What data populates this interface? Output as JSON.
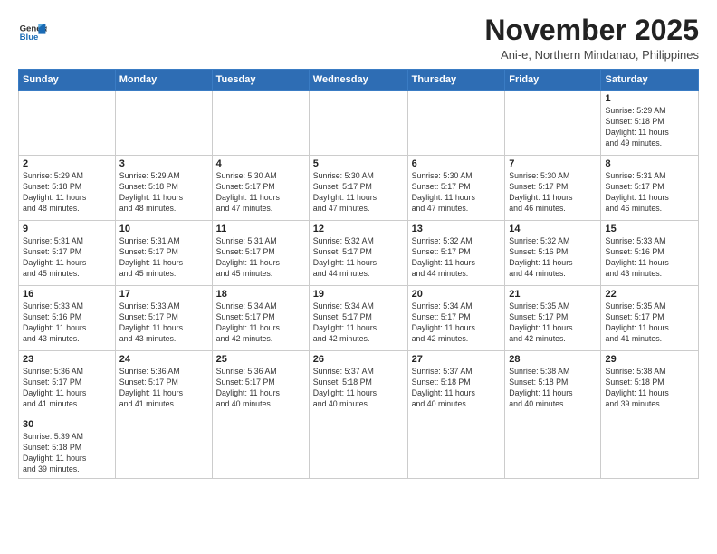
{
  "logo": {
    "line1": "General",
    "line2": "Blue"
  },
  "title": "November 2025",
  "subtitle": "Ani-e, Northern Mindanao, Philippines",
  "weekdays": [
    "Sunday",
    "Monday",
    "Tuesday",
    "Wednesday",
    "Thursday",
    "Friday",
    "Saturday"
  ],
  "weeks": [
    [
      {
        "day": "",
        "info": ""
      },
      {
        "day": "",
        "info": ""
      },
      {
        "day": "",
        "info": ""
      },
      {
        "day": "",
        "info": ""
      },
      {
        "day": "",
        "info": ""
      },
      {
        "day": "",
        "info": ""
      },
      {
        "day": "1",
        "info": "Sunrise: 5:29 AM\nSunset: 5:18 PM\nDaylight: 11 hours\nand 49 minutes."
      }
    ],
    [
      {
        "day": "2",
        "info": "Sunrise: 5:29 AM\nSunset: 5:18 PM\nDaylight: 11 hours\nand 48 minutes."
      },
      {
        "day": "3",
        "info": "Sunrise: 5:29 AM\nSunset: 5:18 PM\nDaylight: 11 hours\nand 48 minutes."
      },
      {
        "day": "4",
        "info": "Sunrise: 5:30 AM\nSunset: 5:17 PM\nDaylight: 11 hours\nand 47 minutes."
      },
      {
        "day": "5",
        "info": "Sunrise: 5:30 AM\nSunset: 5:17 PM\nDaylight: 11 hours\nand 47 minutes."
      },
      {
        "day": "6",
        "info": "Sunrise: 5:30 AM\nSunset: 5:17 PM\nDaylight: 11 hours\nand 47 minutes."
      },
      {
        "day": "7",
        "info": "Sunrise: 5:30 AM\nSunset: 5:17 PM\nDaylight: 11 hours\nand 46 minutes."
      },
      {
        "day": "8",
        "info": "Sunrise: 5:31 AM\nSunset: 5:17 PM\nDaylight: 11 hours\nand 46 minutes."
      }
    ],
    [
      {
        "day": "9",
        "info": "Sunrise: 5:31 AM\nSunset: 5:17 PM\nDaylight: 11 hours\nand 45 minutes."
      },
      {
        "day": "10",
        "info": "Sunrise: 5:31 AM\nSunset: 5:17 PM\nDaylight: 11 hours\nand 45 minutes."
      },
      {
        "day": "11",
        "info": "Sunrise: 5:31 AM\nSunset: 5:17 PM\nDaylight: 11 hours\nand 45 minutes."
      },
      {
        "day": "12",
        "info": "Sunrise: 5:32 AM\nSunset: 5:17 PM\nDaylight: 11 hours\nand 44 minutes."
      },
      {
        "day": "13",
        "info": "Sunrise: 5:32 AM\nSunset: 5:17 PM\nDaylight: 11 hours\nand 44 minutes."
      },
      {
        "day": "14",
        "info": "Sunrise: 5:32 AM\nSunset: 5:16 PM\nDaylight: 11 hours\nand 44 minutes."
      },
      {
        "day": "15",
        "info": "Sunrise: 5:33 AM\nSunset: 5:16 PM\nDaylight: 11 hours\nand 43 minutes."
      }
    ],
    [
      {
        "day": "16",
        "info": "Sunrise: 5:33 AM\nSunset: 5:16 PM\nDaylight: 11 hours\nand 43 minutes."
      },
      {
        "day": "17",
        "info": "Sunrise: 5:33 AM\nSunset: 5:17 PM\nDaylight: 11 hours\nand 43 minutes."
      },
      {
        "day": "18",
        "info": "Sunrise: 5:34 AM\nSunset: 5:17 PM\nDaylight: 11 hours\nand 42 minutes."
      },
      {
        "day": "19",
        "info": "Sunrise: 5:34 AM\nSunset: 5:17 PM\nDaylight: 11 hours\nand 42 minutes."
      },
      {
        "day": "20",
        "info": "Sunrise: 5:34 AM\nSunset: 5:17 PM\nDaylight: 11 hours\nand 42 minutes."
      },
      {
        "day": "21",
        "info": "Sunrise: 5:35 AM\nSunset: 5:17 PM\nDaylight: 11 hours\nand 42 minutes."
      },
      {
        "day": "22",
        "info": "Sunrise: 5:35 AM\nSunset: 5:17 PM\nDaylight: 11 hours\nand 41 minutes."
      }
    ],
    [
      {
        "day": "23",
        "info": "Sunrise: 5:36 AM\nSunset: 5:17 PM\nDaylight: 11 hours\nand 41 minutes."
      },
      {
        "day": "24",
        "info": "Sunrise: 5:36 AM\nSunset: 5:17 PM\nDaylight: 11 hours\nand 41 minutes."
      },
      {
        "day": "25",
        "info": "Sunrise: 5:36 AM\nSunset: 5:17 PM\nDaylight: 11 hours\nand 40 minutes."
      },
      {
        "day": "26",
        "info": "Sunrise: 5:37 AM\nSunset: 5:18 PM\nDaylight: 11 hours\nand 40 minutes."
      },
      {
        "day": "27",
        "info": "Sunrise: 5:37 AM\nSunset: 5:18 PM\nDaylight: 11 hours\nand 40 minutes."
      },
      {
        "day": "28",
        "info": "Sunrise: 5:38 AM\nSunset: 5:18 PM\nDaylight: 11 hours\nand 40 minutes."
      },
      {
        "day": "29",
        "info": "Sunrise: 5:38 AM\nSunset: 5:18 PM\nDaylight: 11 hours\nand 39 minutes."
      }
    ],
    [
      {
        "day": "30",
        "info": "Sunrise: 5:39 AM\nSunset: 5:18 PM\nDaylight: 11 hours\nand 39 minutes."
      },
      {
        "day": "",
        "info": ""
      },
      {
        "day": "",
        "info": ""
      },
      {
        "day": "",
        "info": ""
      },
      {
        "day": "",
        "info": ""
      },
      {
        "day": "",
        "info": ""
      },
      {
        "day": "",
        "info": ""
      }
    ]
  ]
}
